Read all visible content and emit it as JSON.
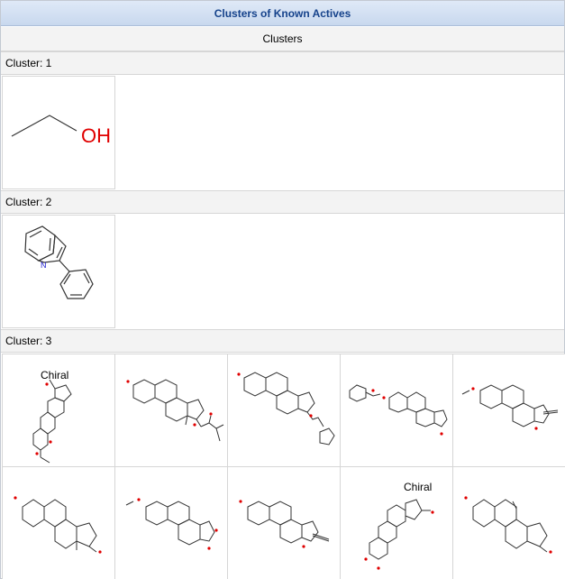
{
  "panel": {
    "title": "Clusters of Known Actives",
    "subtitle": "Clusters"
  },
  "clusters": [
    {
      "label": "Cluster: 1",
      "molecules": [
        {
          "name": "ethanol",
          "atom_label": "OH"
        }
      ]
    },
    {
      "label": "Cluster: 2",
      "molecules": [
        {
          "name": "2-phenylindole",
          "atom_label": "N"
        }
      ]
    },
    {
      "label": "Cluster: 3",
      "molecules": [
        {
          "name": "steroid-1",
          "annotation": "Chiral"
        },
        {
          "name": "steroid-2"
        },
        {
          "name": "steroid-3"
        },
        {
          "name": "steroid-4"
        },
        {
          "name": "steroid-5"
        },
        {
          "name": "steroid-6"
        },
        {
          "name": "steroid-7"
        },
        {
          "name": "steroid-8"
        },
        {
          "name": "steroid-9",
          "annotation": "Chiral"
        },
        {
          "name": "steroid-10"
        }
      ]
    }
  ],
  "colors": {
    "oxygen": "#e00000",
    "nitrogen": "#2020d0",
    "bond": "#333333"
  }
}
